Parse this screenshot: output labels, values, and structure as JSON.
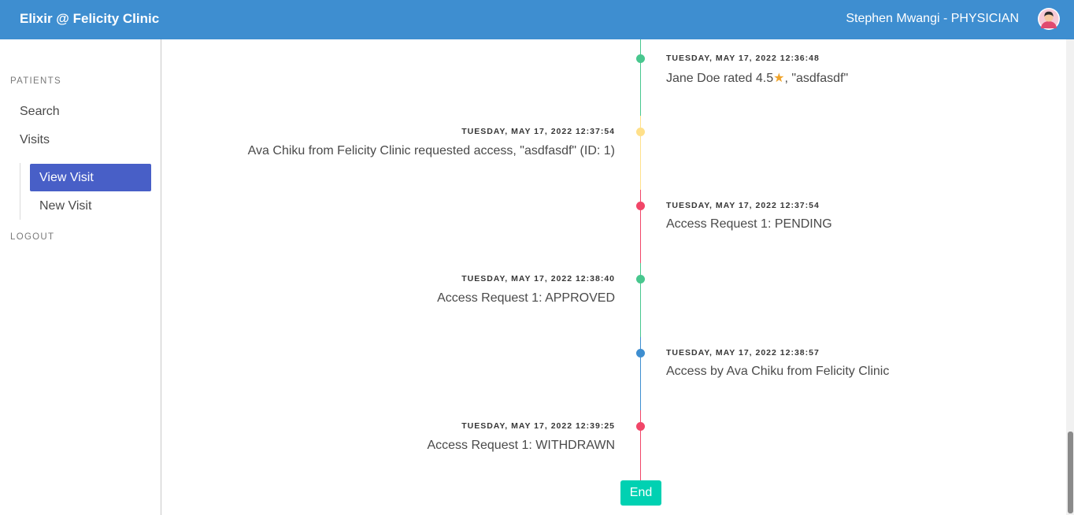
{
  "header": {
    "brand": "Elixir @ Felicity Clinic",
    "user": "Stephen Mwangi - PHYSICIAN",
    "avatar_icon": "user-avatar-icon",
    "color": "#3e8ed0"
  },
  "sidebar": {
    "patients_label": "PATIENTS",
    "search": "Search",
    "visits": "Visits",
    "view_visit": "View Visit",
    "new_visit": "New Visit",
    "logout": "LOGOUT"
  },
  "timeline": {
    "events": [
      {
        "timestamp": "TUESDAY, MAY 17, 2022 12:36:48",
        "text_before": "Jane Doe rated 4.5",
        "star": "★",
        "text_after": ", \"asdfasdf\"",
        "color": "#48c78e",
        "side": "right"
      },
      {
        "timestamp": "TUESDAY, MAY 17, 2022 12:37:54",
        "text": "Ava Chiku from Felicity Clinic requested access, \"asdfasdf\" (ID: 1)",
        "color": "#ffe08a",
        "side": "left"
      },
      {
        "timestamp": "TUESDAY, MAY 17, 2022 12:37:54",
        "text": "Access Request 1: PENDING",
        "color": "#f14668",
        "side": "right"
      },
      {
        "timestamp": "TUESDAY, MAY 17, 2022 12:38:40",
        "text": "Access Request 1: APPROVED",
        "color": "#48c78e",
        "side": "left"
      },
      {
        "timestamp": "TUESDAY, MAY 17, 2022 12:38:57",
        "text": "Access by Ava Chiku from Felicity Clinic",
        "color": "#3e8ed0",
        "side": "right"
      },
      {
        "timestamp": "TUESDAY, MAY 17, 2022 12:39:25",
        "text": "Access Request 1: WITHDRAWN",
        "color": "#f14668",
        "side": "left"
      }
    ],
    "end_label": "End"
  }
}
